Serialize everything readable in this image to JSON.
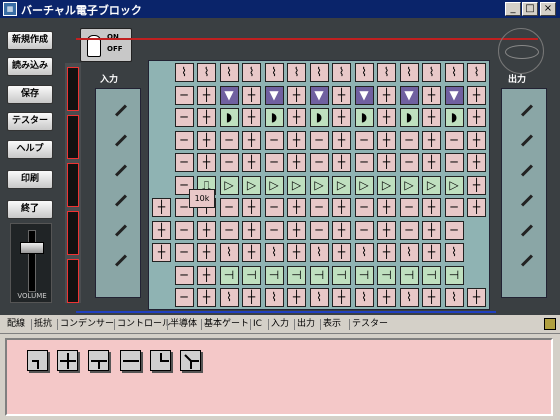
{
  "window": {
    "title": "バーチャル電子ブロック",
    "minimize": "_",
    "maximize": "□",
    "close": "×"
  },
  "sidebar": {
    "buttons": [
      "新規作成",
      "読み込み",
      "保存",
      "テスター",
      "ヘルプ",
      "印刷",
      "終了"
    ],
    "volume_label": "VOLUME"
  },
  "power": {
    "on": "ON",
    "off": "OFF"
  },
  "panels": {
    "input_label": "入力",
    "output_label": "出力"
  },
  "board": {
    "resistor_value": "10k"
  },
  "tabs": [
    "配線",
    "抵抗",
    "コンデンサー",
    "コントロール",
    "半導体",
    "基本ゲート",
    "IC",
    "入力",
    "出力",
    "表示",
    "テスター"
  ],
  "palette": {
    "items": [
      "wire-corner",
      "wire-cross",
      "wire-tee",
      "wire-straight",
      "wire-corner-2",
      "wire-diagonal"
    ]
  }
}
